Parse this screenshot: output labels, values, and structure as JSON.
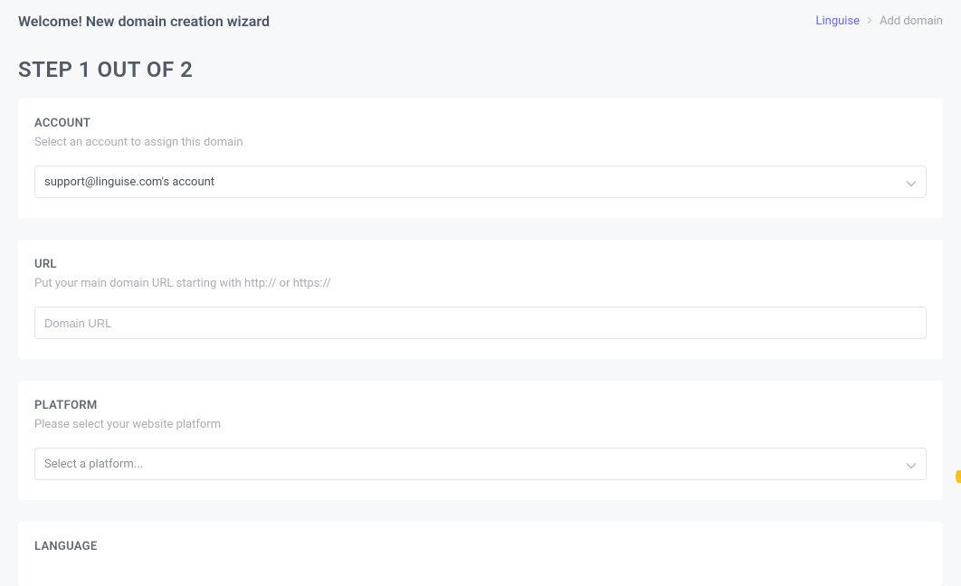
{
  "header": {
    "welcome_title": "Welcome! New domain creation wizard",
    "breadcrumb": {
      "root": "Linguise",
      "current": "Add domain"
    }
  },
  "step_heading": "STEP 1 OUT OF 2",
  "account_card": {
    "label": "ACCOUNT",
    "helper": "Select an account to assign this domain",
    "selected_value": "support@linguise.com's account"
  },
  "url_card": {
    "label": "URL",
    "helper": "Put your main domain URL starting with http:// or https://",
    "placeholder": "Domain URL",
    "value": ""
  },
  "platform_card": {
    "label": "PLATFORM",
    "helper": "Please select your website platform",
    "placeholder": "Select a platform..."
  },
  "language_card": {
    "label": "LANGUAGE"
  },
  "colors": {
    "accent": "#6366f1",
    "page_bg": "#f7f8fa",
    "card_bg": "#ffffff",
    "border": "#e1e4e8"
  }
}
